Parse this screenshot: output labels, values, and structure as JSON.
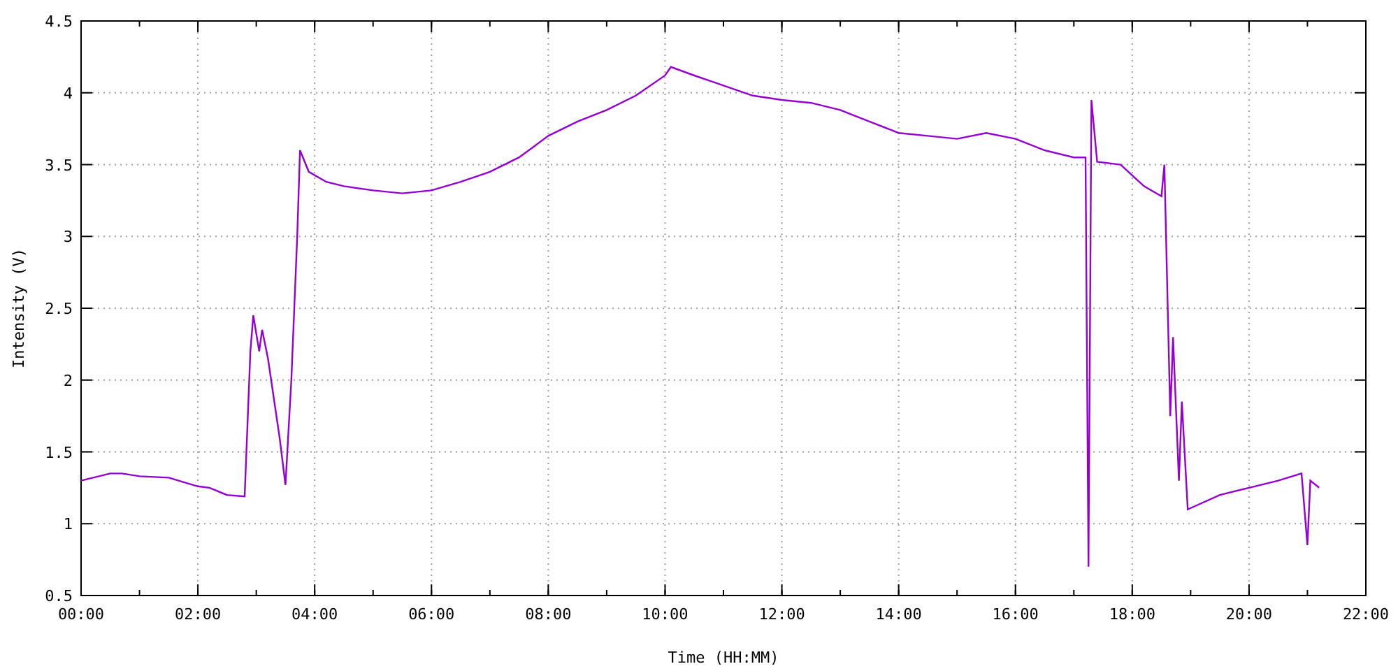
{
  "chart": {
    "chart_data": {
      "type": "line",
      "xlabel": "Time (HH:MM)",
      "ylabel": "Intensity (V)",
      "x": [
        0,
        0.5,
        0.7,
        1,
        1.5,
        2,
        2.2,
        2.5,
        2.8,
        2.9,
        2.95,
        3.05,
        3.1,
        3.2,
        3.4,
        3.5,
        3.6,
        3.7,
        3.75,
        3.9,
        4.2,
        4.5,
        5,
        5.5,
        6,
        6.5,
        7,
        7.5,
        8,
        8.5,
        9,
        9.5,
        10,
        10.1,
        10.5,
        11,
        11.5,
        12,
        12.5,
        13,
        13.5,
        14,
        14.5,
        15,
        15.5,
        16,
        16.5,
        17,
        17.2,
        17.25,
        17.3,
        17.4,
        17.8,
        18.2,
        18.5,
        18.55,
        18.65,
        18.7,
        18.8,
        18.85,
        18.95,
        19.5,
        20,
        20.5,
        20.9,
        21,
        21.05,
        21.2
      ],
      "series": [
        {
          "color": "#9400d3",
          "values": [
            1.3,
            1.35,
            1.35,
            1.33,
            1.32,
            1.26,
            1.25,
            1.2,
            1.19,
            2.2,
            2.45,
            2.2,
            2.35,
            2.15,
            1.6,
            1.27,
            2.0,
            3.0,
            3.6,
            3.45,
            3.38,
            3.35,
            3.32,
            3.3,
            3.32,
            3.38,
            3.45,
            3.55,
            3.7,
            3.8,
            3.88,
            3.98,
            4.12,
            4.18,
            4.12,
            4.05,
            3.98,
            3.95,
            3.93,
            3.88,
            3.8,
            3.72,
            3.7,
            3.68,
            3.72,
            3.68,
            3.6,
            3.55,
            3.55,
            0.7,
            3.95,
            3.52,
            3.5,
            3.35,
            3.28,
            3.5,
            1.75,
            2.3,
            1.3,
            1.85,
            1.1,
            1.2,
            1.25,
            1.3,
            1.35,
            0.85,
            1.3,
            1.25
          ]
        }
      ],
      "xlim": [
        0,
        22
      ],
      "ylim": [
        0.5,
        4.5
      ],
      "xticks": [
        {
          "value": 0,
          "label": "00:00"
        },
        {
          "value": 2,
          "label": "02:00"
        },
        {
          "value": 4,
          "label": "04:00"
        },
        {
          "value": 6,
          "label": "06:00"
        },
        {
          "value": 8,
          "label": "08:00"
        },
        {
          "value": 10,
          "label": "10:00"
        },
        {
          "value": 12,
          "label": "12:00"
        },
        {
          "value": 14,
          "label": "14:00"
        },
        {
          "value": 16,
          "label": "16:00"
        },
        {
          "value": 18,
          "label": "18:00"
        },
        {
          "value": 20,
          "label": "20:00"
        },
        {
          "value": 22,
          "label": "22:00"
        }
      ],
      "yticks": [
        0.5,
        1,
        1.5,
        2,
        2.5,
        3,
        3.5,
        4,
        4.5
      ],
      "grid": true
    }
  }
}
